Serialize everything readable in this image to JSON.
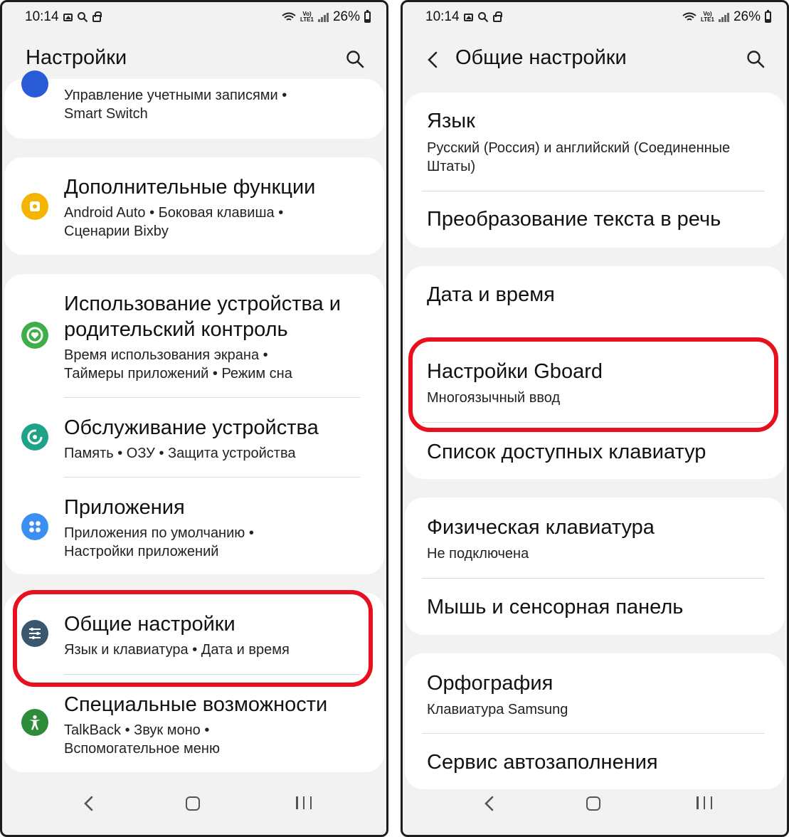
{
  "status": {
    "time": "10:14",
    "network": "Vo)) LTE1",
    "battery": "26%",
    "battery_level": 0.26
  },
  "left": {
    "title": "Настройки",
    "card0": {
      "subtitle_line1": "Управление учетными записями  •",
      "subtitle_line2": "Smart Switch"
    },
    "advanced": {
      "title": "Дополнительные функции",
      "subtitle_line1": "Android Auto  •  Боковая клавиша  •",
      "subtitle_line2": "Сценарии Bixby"
    },
    "wellbeing": {
      "title_line1": "Использование устройства и",
      "title_line2": "родительский контроль",
      "subtitle_line1": "Время использования экрана  •",
      "subtitle_line2": "Таймеры приложений  •  Режим сна"
    },
    "care": {
      "title": "Обслуживание устройства",
      "subtitle": "Память  •  ОЗУ  •  Защита устройства"
    },
    "apps": {
      "title": "Приложения",
      "subtitle_line1": "Приложения по умолчанию  •",
      "subtitle_line2": "Настройки приложений"
    },
    "general": {
      "title": "Общие настройки",
      "subtitle": "Язык и клавиатура  •  Дата и время"
    },
    "accessibility": {
      "title": "Специальные возможности",
      "subtitle_line1": "TalkBack  •  Звук моно  •",
      "subtitle_line2": "Вспомогательное меню"
    }
  },
  "right": {
    "title": "Общие настройки",
    "language": {
      "title": "Язык",
      "subtitle_line1": "Русский (Россия) и английский (Соединенные",
      "subtitle_line2": "Штаты)"
    },
    "tts": {
      "title": "Преобразование текста в речь"
    },
    "datetime": {
      "title": "Дата и время"
    },
    "gboard": {
      "title": "Настройки Gboard",
      "subtitle": "Многоязычный ввод"
    },
    "keyboards": {
      "title": "Список доступных клавиатур"
    },
    "physical": {
      "title": "Физическая клавиатура",
      "subtitle": "Не подключена"
    },
    "mouse": {
      "title": "Мышь и сенсорная панель"
    },
    "spelling": {
      "title": "Орфография",
      "subtitle": "Клавиатура Samsung"
    },
    "autofill": {
      "title": "Сервис автозаполнения"
    }
  },
  "colors": {
    "advanced_icon": "#f5b400",
    "wellbeing_icon": "#3fae49",
    "care_icon": "#1ea388",
    "apps_icon": "#3b8ff0",
    "general_icon": "#3a5770",
    "accessibility_icon": "#2e8b3a",
    "highlight": "#e8101e"
  },
  "icons": {
    "advanced": "puzzle-gear-icon",
    "wellbeing": "heart-circle-icon",
    "care": "refresh-circle-icon",
    "apps": "four-dots-icon",
    "general": "sliders-icon",
    "accessibility": "person-icon"
  }
}
